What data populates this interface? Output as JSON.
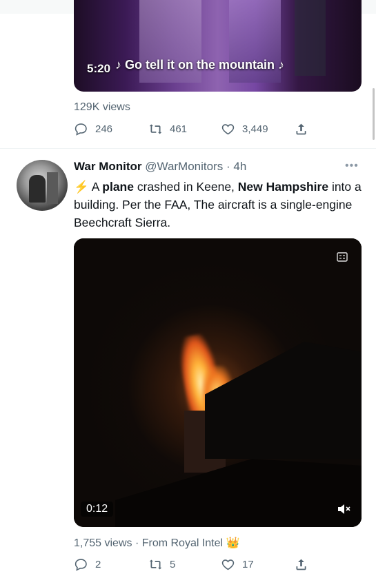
{
  "tweet1": {
    "video": {
      "time": "5:20",
      "caption": "♪ Go tell it on the mountain ♪"
    },
    "views": "129K views",
    "actions": {
      "reply": "246",
      "retweet": "461",
      "like": "3,449"
    }
  },
  "tweet2": {
    "author": "War Monitor",
    "handle": "@WarMonitors",
    "time": "4h",
    "more": "•••",
    "text": {
      "bolt": "⚡",
      "p1": " A ",
      "b1": "plane",
      "p2": " crashed in Keene, ",
      "b2": "New Hampshire",
      "p3": " into a building.  Per the FAA, The aircraft is a single-engine Beechcraft Sierra."
    },
    "video": {
      "time": "0:12"
    },
    "views": "1,755 views · From Royal Intel",
    "crown": "👑",
    "actions": {
      "reply": "2",
      "retweet": "5",
      "like": "17"
    }
  },
  "colors": {
    "accent": "#1d9bf0",
    "muted": "#536471",
    "text": "#0f1419"
  }
}
